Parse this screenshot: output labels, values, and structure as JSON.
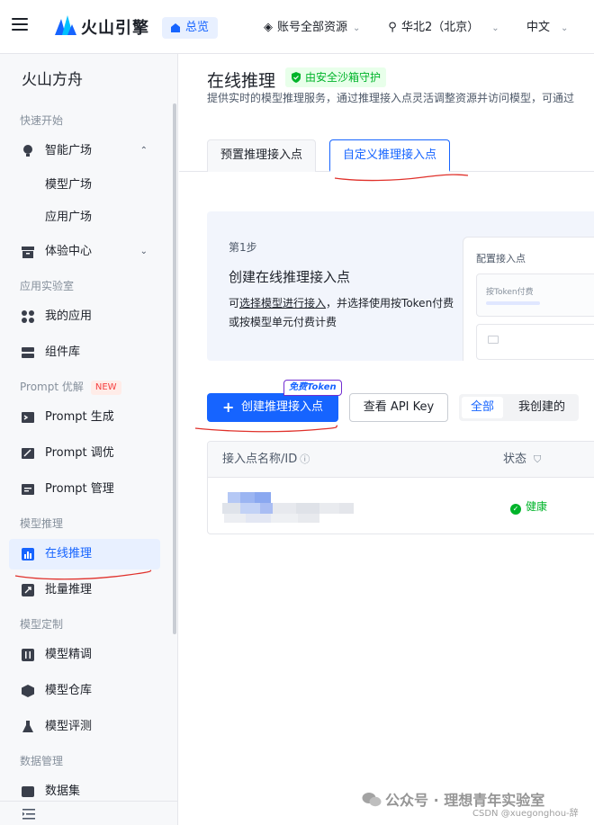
{
  "topbar": {
    "brand": "火山引擎",
    "home": "总览",
    "account": "账号全部资源",
    "region": "华北2（北京）",
    "language": "中文"
  },
  "sidebar": {
    "title": "火山方舟",
    "groups": {
      "quickstart": "快速开始",
      "applab": "应用实验室",
      "prompt": "Prompt 优解",
      "inference": "模型推理",
      "custom": "模型定制",
      "data": "数据管理"
    },
    "new_badge": "NEW",
    "items": {
      "square": "智能广场",
      "model_square": "模型广场",
      "app_square": "应用广场",
      "experience": "体验中心",
      "my_apps": "我的应用",
      "components": "组件库",
      "prompt_gen": "Prompt 生成",
      "prompt_tune": "Prompt 调优",
      "prompt_manage": "Prompt 管理",
      "online_inference": "在线推理",
      "batch_inference": "批量推理",
      "finetune": "模型精调",
      "repository": "模型仓库",
      "evaluation": "模型评测",
      "dataset": "数据集"
    }
  },
  "main": {
    "title": "在线推理",
    "safe_tag": "由安全沙箱守护",
    "description": "提供实时的模型推理服务，通过推理接入点灵活调整资源并访问模型，可通过",
    "tabs": [
      "预置推理接入点",
      "自定义推理接入点"
    ],
    "step": {
      "label": "第1步",
      "title": "创建在线推理接入点",
      "desc_pre": "可",
      "desc_link": "选择模型进行接入",
      "desc_post": "，并选择使用按Token付费或按模型单元付费计费"
    },
    "preview": {
      "title": "配置接入点",
      "option": "按Token付费"
    },
    "create_button": "创建推理接入点",
    "free_badge": "免费Token",
    "apikey_button": "查看 API Key",
    "filter": [
      "全部",
      "我创建的"
    ],
    "table": {
      "col_name": "接入点名称/ID",
      "col_status": "状态",
      "rows": [
        {
          "status": "健康"
        }
      ]
    }
  },
  "watermark": {
    "main": "公众号 · 理想青年实验室",
    "sub": "CSDN @xuegonghou-辞"
  },
  "colors": {
    "accent": "#1664ff",
    "success": "#00b42a",
    "annotation": "#e0312b"
  }
}
